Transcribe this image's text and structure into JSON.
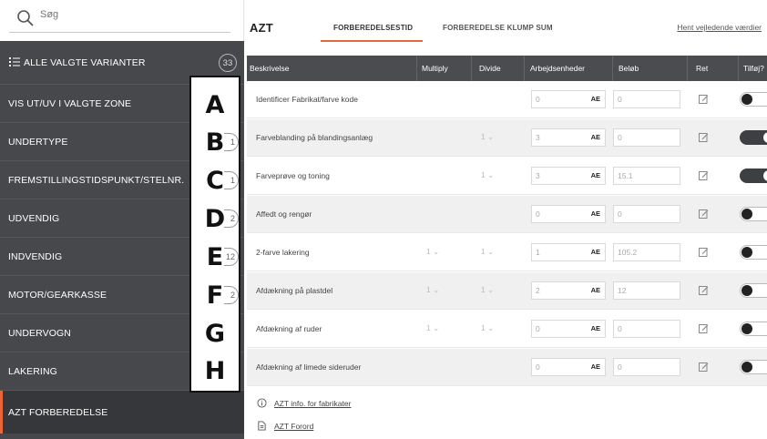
{
  "sidebar": {
    "search_placeholder": "Søg",
    "all_variants": {
      "label": "ALLE VALGTE VARIANTER",
      "count": "33"
    },
    "items": [
      {
        "label": "VIS UT/UV I VALGTE ZONE"
      },
      {
        "label": "UNDERTYPE",
        "count": "1"
      },
      {
        "label": "FREMSTILLINGSTIDSPUNKT/STELNR.",
        "count": "1"
      },
      {
        "label": "UDVENDIG",
        "count": "2"
      },
      {
        "label": "INDVENDIG",
        "count": "12"
      },
      {
        "label": "MOTOR/GEARKASSE",
        "count": "2"
      },
      {
        "label": "UNDERVOGN"
      },
      {
        "label": "LAKERING"
      },
      {
        "label": "AZT FORBEREDELSE"
      }
    ],
    "overlay_letters": [
      "A",
      "B",
      "C",
      "D",
      "E",
      "F",
      "G",
      "H"
    ]
  },
  "header": {
    "title": "AZT",
    "tabs": [
      {
        "label": "FORBEREDELSESTID"
      },
      {
        "label": "FORBEREDELSE KLUMP SUM"
      }
    ],
    "link": "Hent vejledende værdier"
  },
  "table": {
    "columns": [
      "Beskrivelse",
      "Multiply",
      "Divide",
      "Arbejdsenheder",
      "Beløb",
      "Ret",
      "Tilføj?"
    ],
    "unit": "AE",
    "rows": [
      {
        "desc": "Identificer Fabrikat/farve kode",
        "multiply": "",
        "divide": "",
        "ae": "0",
        "amount": "0",
        "toggle": false
      },
      {
        "desc": "Farveblanding på blandingsanlæg",
        "multiply": "",
        "divide": "1",
        "ae": "3",
        "amount": "0",
        "toggle": true
      },
      {
        "desc": "Farveprøve og toning",
        "multiply": "",
        "divide": "1",
        "ae": "3",
        "amount": "15.1",
        "toggle": true
      },
      {
        "desc": "Affedt og rengør",
        "multiply": "",
        "divide": "",
        "ae": "0",
        "amount": "0",
        "toggle": false
      },
      {
        "desc": "2-farve lakering",
        "multiply": "1",
        "divide": "1",
        "ae": "1",
        "amount": "105.2",
        "toggle": false
      },
      {
        "desc": "Afdækning på plastdel",
        "multiply": "1",
        "divide": "1",
        "ae": "2",
        "amount": "12",
        "toggle": false
      },
      {
        "desc": "Afdækning af ruder",
        "multiply": "1",
        "divide": "1",
        "ae": "0",
        "amount": "0",
        "toggle": false
      },
      {
        "desc": "Afdækning af limede sideruder",
        "multiply": "",
        "divide": "",
        "ae": "0",
        "amount": "0",
        "toggle": false
      }
    ]
  },
  "footer": {
    "info_link": "AZT info. for fabrikater",
    "doc_link": "AZT Forord"
  }
}
